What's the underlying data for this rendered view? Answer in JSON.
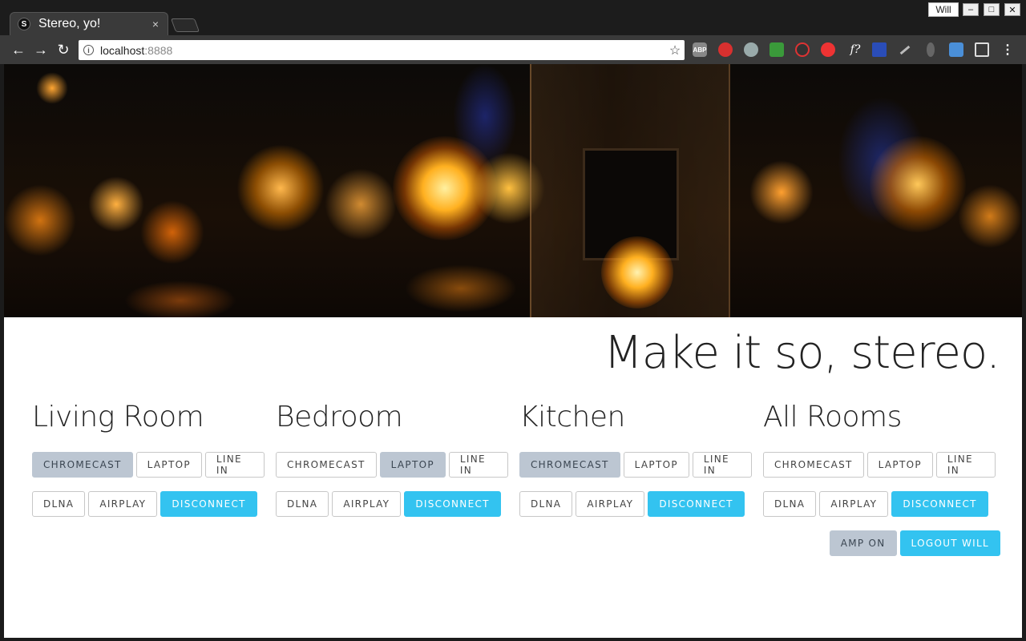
{
  "browser": {
    "tab_title": "Stereo, yo!",
    "favicon_letter": "S",
    "tab_close": "×",
    "profile_name": "Will",
    "url_host": "localhost",
    "url_port": ":8888",
    "window_controls": {
      "minimize": "–",
      "maximize": "□",
      "close": "✕"
    },
    "extensions": [
      "abp-icon",
      "lastpass-icon",
      "python-icon",
      "refresh-ext-icon",
      "opera-icon",
      "vivaldi-icon",
      "font-ext-icon",
      "barcode-icon",
      "eyedropper-icon",
      "bulb-icon",
      "screenshot-icon",
      "capture-icon",
      "menu-icon"
    ],
    "ext_labels": {
      "abp": "ABP",
      "font": "f?"
    }
  },
  "page": {
    "headline": "Make it so, stereo.",
    "accent_color": "#33c3f0",
    "active_color": "#bcc6d2"
  },
  "rooms": [
    {
      "name": "Living Room",
      "row1": [
        "CHROMECAST",
        "LAPTOP",
        "LINE IN"
      ],
      "row2": [
        "DLNA",
        "AIRPLAY",
        "DISCONNECT"
      ],
      "active": "CHROMECAST"
    },
    {
      "name": "Bedroom",
      "row1": [
        "CHROMECAST",
        "LAPTOP",
        "LINE IN"
      ],
      "row2": [
        "DLNA",
        "AIRPLAY",
        "DISCONNECT"
      ],
      "active": "LAPTOP"
    },
    {
      "name": "Kitchen",
      "row1": [
        "CHROMECAST",
        "LAPTOP",
        "LINE IN"
      ],
      "row2": [
        "DLNA",
        "AIRPLAY",
        "DISCONNECT"
      ],
      "active": "CHROMECAST"
    },
    {
      "name": "All Rooms",
      "row1": [
        "CHROMECAST",
        "LAPTOP",
        "LINE IN"
      ],
      "row2": [
        "DLNA",
        "AIRPLAY",
        "DISCONNECT"
      ],
      "active": ""
    }
  ],
  "footer": {
    "amp_label": "AMP ON",
    "logout_label": "LOGOUT WILL"
  }
}
